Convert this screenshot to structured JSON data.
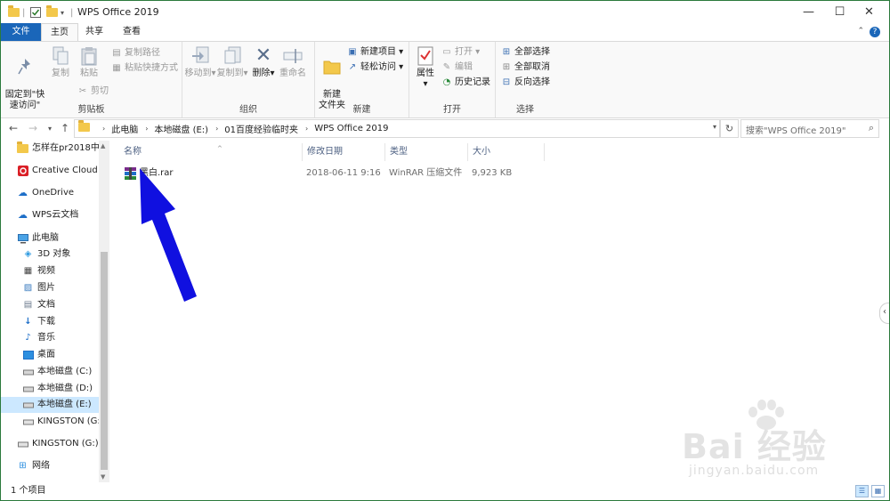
{
  "window": {
    "title": "WPS Office 2019",
    "accent": "#1a66b9",
    "border": "#2b7a3c"
  },
  "title_buttons": {
    "minimize": "—",
    "maximize": "☐",
    "close": "✕"
  },
  "tabs": [
    {
      "label": "文件"
    },
    {
      "label": "主页"
    },
    {
      "label": "共享"
    },
    {
      "label": "查看"
    }
  ],
  "ribbon": {
    "pin_quick": "固定到\"快\n速访问\"",
    "copy": "复制",
    "paste": "粘贴",
    "copy_path": "复制路径",
    "paste_shortcut": "粘贴快捷方式",
    "cut": "剪切",
    "clipboard_group": "剪贴板",
    "move_to": "移动到",
    "copy_to": "复制到",
    "delete": "删除",
    "rename": "重命名",
    "organize_group": "组织",
    "new_folder": "新建\n文件夹",
    "new_item": "新建项目",
    "easy_access": "轻松访问",
    "new_group": "新建",
    "properties": "属性",
    "open": "打开",
    "edit": "编辑",
    "history": "历史记录",
    "open_group": "打开",
    "select_all": "全部选择",
    "select_none": "全部取消",
    "invert_selection": "反向选择",
    "select_group": "选择"
  },
  "address": {
    "crumbs": [
      "此电脑",
      "本地磁盘 (E:)",
      "01百度经验临时夹",
      "WPS Office 2019"
    ],
    "search_placeholder": "搜索\"WPS Office 2019\""
  },
  "nav_items": [
    {
      "label": "怎样在pr2018中",
      "icon": "folder-icon",
      "selected": false
    },
    {
      "label": "Creative Cloud F",
      "icon": "creative-cloud-icon",
      "selected": false
    },
    {
      "label": "OneDrive",
      "icon": "onedrive-icon",
      "selected": false
    },
    {
      "label": "WPS云文档",
      "icon": "wps-cloud-icon",
      "selected": false
    },
    {
      "label": "此电脑",
      "icon": "computer-icon",
      "selected": false
    },
    {
      "label": "3D 对象",
      "icon": "3d-objects-icon",
      "selected": false
    },
    {
      "label": "视频",
      "icon": "video-icon",
      "selected": false
    },
    {
      "label": "图片",
      "icon": "pictures-icon",
      "selected": false
    },
    {
      "label": "文档",
      "icon": "documents-icon",
      "selected": false
    },
    {
      "label": "下载",
      "icon": "download-icon",
      "selected": false
    },
    {
      "label": "音乐",
      "icon": "music-icon",
      "selected": false
    },
    {
      "label": "桌面",
      "icon": "desktop-icon",
      "selected": false
    },
    {
      "label": "本地磁盘 (C:)",
      "icon": "drive-icon",
      "selected": false
    },
    {
      "label": "本地磁盘 (D:)",
      "icon": "drive-icon",
      "selected": false
    },
    {
      "label": "本地磁盘 (E:)",
      "icon": "drive-icon",
      "selected": true
    },
    {
      "label": "KINGSTON (G:",
      "icon": "usb-drive-icon",
      "selected": false
    },
    {
      "label": "KINGSTON (G:)",
      "icon": "usb-drive-icon",
      "selected": false
    },
    {
      "label": "网络",
      "icon": "network-icon",
      "selected": false
    }
  ],
  "columns": {
    "name": "名称",
    "modified": "修改日期",
    "type": "类型",
    "size": "大小"
  },
  "files": [
    {
      "name": "黑白.rar",
      "modified": "2018-06-11 9:16",
      "type": "WinRAR 压缩文件",
      "size": "9,923 KB"
    }
  ],
  "status": {
    "count": "1 个项目"
  },
  "annotation": {
    "arrow_color": "#1010e0"
  },
  "watermark": {
    "brand": "Bai 经验",
    "url": "jingyan.baidu.com"
  }
}
